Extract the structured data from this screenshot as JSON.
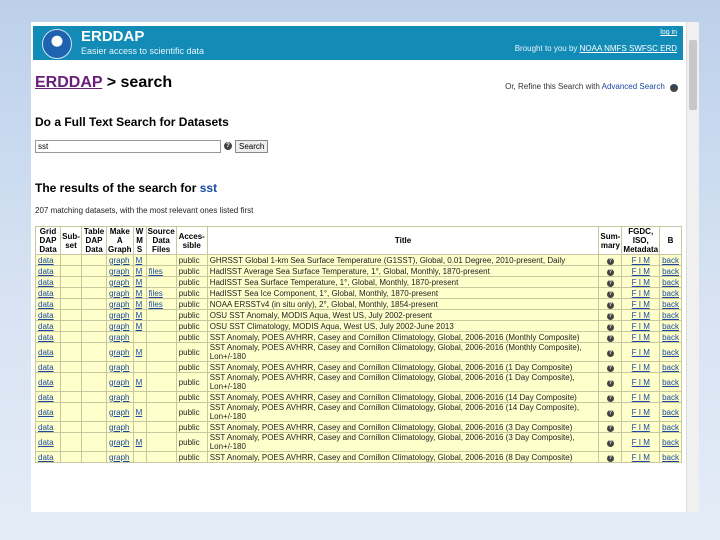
{
  "banner": {
    "title": "ERDDAP",
    "subtitle": "Easier access to scientific data",
    "top_link": "log in",
    "brought_prefix": "Brought to you by",
    "brought_links": "NOAA NMFS SWFSC ERD"
  },
  "breadcrumb": {
    "home": "ERDDAP",
    "sep": " > ",
    "current": "search"
  },
  "refine": {
    "prefix": "Or, Refine this Search with",
    "link": "Advanced Search"
  },
  "search": {
    "heading": "Do a Full Text Search for Datasets",
    "value": "sst",
    "button": "Search",
    "help": "?"
  },
  "results": {
    "heading_prefix": "The results of the search for",
    "term": "sst",
    "count_text": "207 matching datasets, with the most relevant ones listed first"
  },
  "table": {
    "headers": [
      [
        "Grid",
        "DAP",
        "Data"
      ],
      [
        "Sub-",
        "set"
      ],
      [
        "Table",
        "DAP",
        "Data"
      ],
      [
        "Make",
        "A",
        "Graph"
      ],
      [
        "W",
        "M",
        "S"
      ],
      [
        "Source",
        "Data",
        "Files"
      ],
      [
        "Acces-",
        "sible"
      ],
      [
        "Title"
      ],
      [
        "Sum-",
        "mary"
      ],
      [
        "FGDC,",
        "ISO,",
        "Metadata"
      ],
      [
        "B"
      ]
    ],
    "rows": [
      {
        "grid": "data",
        "table": "",
        "graph": "graph",
        "wms": "M",
        "files": "",
        "access": "public",
        "title": "GHRSST Global 1-km Sea Surface Temperature (G1SST), Global, 0.01 Degree, 2010-present, Daily",
        "summary": "?",
        "meta": "F I M",
        "back": "back"
      },
      {
        "grid": "data",
        "table": "",
        "graph": "graph",
        "wms": "M",
        "files": "files",
        "access": "public",
        "title": "HadISST Average Sea Surface Temperature, 1°, Global, Monthly, 1870-present",
        "summary": "?",
        "meta": "F I M",
        "back": "back"
      },
      {
        "grid": "data",
        "table": "",
        "graph": "graph",
        "wms": "M",
        "files": "",
        "access": "public",
        "title": "HadISST Sea Surface Temperature, 1°, Global, Monthly, 1870-present",
        "summary": "?",
        "meta": "F I M",
        "back": "back"
      },
      {
        "grid": "data",
        "table": "",
        "graph": "graph",
        "wms": "M",
        "files": "files",
        "access": "public",
        "title": "HadISST Sea Ice Component, 1°, Global, Monthly, 1870-present",
        "summary": "?",
        "meta": "F I M",
        "back": "back"
      },
      {
        "grid": "data",
        "table": "",
        "graph": "graph",
        "wms": "M",
        "files": "files",
        "access": "public",
        "title": "NOAA ERSSTv4 (in situ only), 2°, Global, Monthly, 1854-present",
        "summary": "?",
        "meta": "F I M",
        "back": "back"
      },
      {
        "grid": "data",
        "table": "",
        "graph": "graph",
        "wms": "M",
        "files": "",
        "access": "public",
        "title": "OSU SST Anomaly, MODIS Aqua, West US, July 2002-present",
        "summary": "?",
        "meta": "F I M",
        "back": "back"
      },
      {
        "grid": "data",
        "table": "",
        "graph": "graph",
        "wms": "M",
        "files": "",
        "access": "public",
        "title": "OSU SST Climatology, MODIS Aqua, West US, July 2002-June 2013",
        "summary": "?",
        "meta": "F I M",
        "back": "back"
      },
      {
        "grid": "data",
        "table": "",
        "graph": "graph",
        "wms": "",
        "files": "",
        "access": "public",
        "title": "SST Anomaly, POES AVHRR, Casey and Cornillon Climatology, Global, 2006-2016 (Monthly Composite)",
        "summary": "?",
        "meta": "F I M",
        "back": "back"
      },
      {
        "grid": "data",
        "table": "",
        "graph": "graph",
        "wms": "M",
        "files": "",
        "access": "public",
        "title": "SST Anomaly, POES AVHRR, Casey and Cornillon Climatology, Global, 2006-2016 (Monthly Composite), Lon+/-180",
        "summary": "?",
        "meta": "F I M",
        "back": "back"
      },
      {
        "grid": "data",
        "table": "",
        "graph": "graph",
        "wms": "",
        "files": "",
        "access": "public",
        "title": "SST Anomaly, POES AVHRR, Casey and Cornillon Climatology, Global, 2006-2016 (1 Day Composite)",
        "summary": "?",
        "meta": "F I M",
        "back": "back"
      },
      {
        "grid": "data",
        "table": "",
        "graph": "graph",
        "wms": "M",
        "files": "",
        "access": "public",
        "title": "SST Anomaly, POES AVHRR, Casey and Cornillon Climatology, Global, 2006-2016 (1 Day Composite), Lon+/-180",
        "summary": "?",
        "meta": "F I M",
        "back": "back"
      },
      {
        "grid": "data",
        "table": "",
        "graph": "graph",
        "wms": "",
        "files": "",
        "access": "public",
        "title": "SST Anomaly, POES AVHRR, Casey and Cornillon Climatology, Global, 2006-2016 (14 Day Composite)",
        "summary": "?",
        "meta": "F I M",
        "back": "back"
      },
      {
        "grid": "data",
        "table": "",
        "graph": "graph",
        "wms": "M",
        "files": "",
        "access": "public",
        "title": "SST Anomaly, POES AVHRR, Casey and Cornillon Climatology, Global, 2006-2016 (14 Day Composite), Lon+/-180",
        "summary": "?",
        "meta": "F I M",
        "back": "back"
      },
      {
        "grid": "data",
        "table": "",
        "graph": "graph",
        "wms": "",
        "files": "",
        "access": "public",
        "title": "SST Anomaly, POES AVHRR, Casey and Cornillon Climatology, Global, 2006-2016 (3 Day Composite)",
        "summary": "?",
        "meta": "F I M",
        "back": "back"
      },
      {
        "grid": "data",
        "table": "",
        "graph": "graph",
        "wms": "M",
        "files": "",
        "access": "public",
        "title": "SST Anomaly, POES AVHRR, Casey and Cornillon Climatology, Global, 2006-2016 (3 Day Composite), Lon+/-180",
        "summary": "?",
        "meta": "F I M",
        "back": "back"
      },
      {
        "grid": "data",
        "table": "",
        "graph": "graph",
        "wms": "",
        "files": "",
        "access": "public",
        "title": "SST Anomaly, POES AVHRR, Casey and Cornillon Climatology, Global, 2006-2016 (8 Day Composite)",
        "summary": "?",
        "meta": "F I M",
        "back": "back"
      }
    ]
  },
  "colors": {
    "banner": "#128cb7",
    "row_bg": "#ffffcc",
    "link": "#1a4aa0",
    "home_link": "#68207a"
  }
}
